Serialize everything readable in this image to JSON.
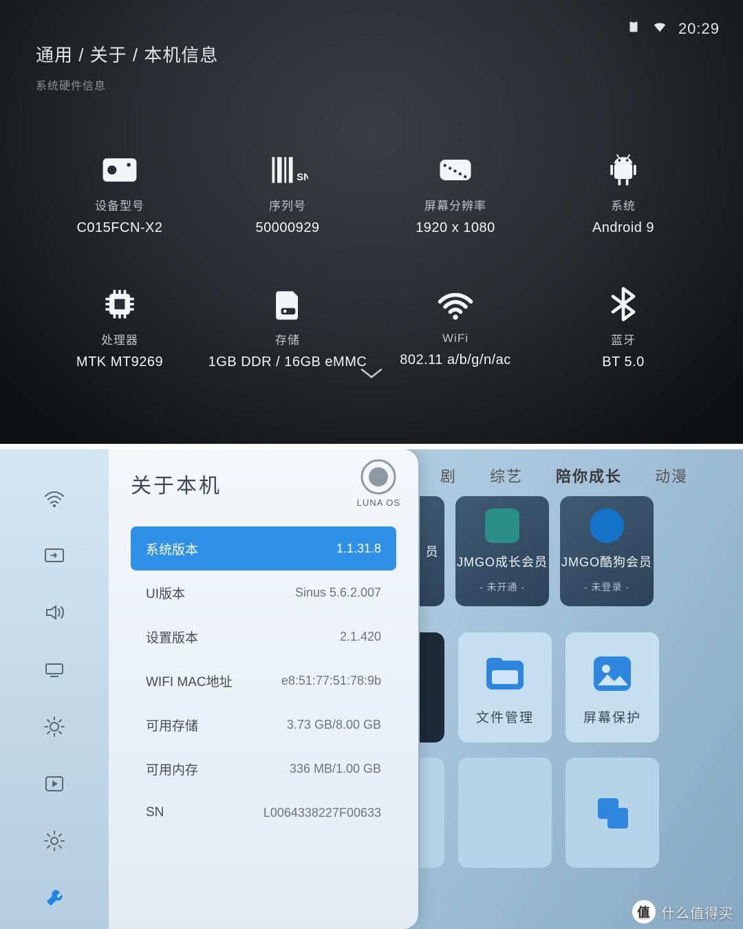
{
  "top": {
    "time": "20:29",
    "breadcrumb": "通用 / 关于 / 本机信息",
    "subtitle": "系统硬件信息",
    "tiles": [
      {
        "label": "设备型号",
        "value": "C015FCN-X2",
        "icon": "device-model-icon"
      },
      {
        "label": "序列号",
        "value": "50000929",
        "icon": "barcode-sn-icon"
      },
      {
        "label": "屏幕分辨率",
        "value": "1920 x 1080",
        "icon": "resolution-icon"
      },
      {
        "label": "系统",
        "value": "Android 9",
        "icon": "android-icon"
      },
      {
        "label": "处理器",
        "value": "MTK MT9269",
        "icon": "cpu-icon"
      },
      {
        "label": "存储",
        "value": "1GB DDR / 16GB eMMC",
        "icon": "storage-icon"
      },
      {
        "label": "WiFi",
        "value": "802.11 a/b/g/n/ac",
        "icon": "wifi-icon"
      },
      {
        "label": "蓝牙",
        "value": "BT 5.0",
        "icon": "bluetooth-icon"
      }
    ]
  },
  "bot": {
    "panel_title": "关于本机",
    "brand": "LUNA OS",
    "rows": [
      {
        "label": "系统版本",
        "value": "1.1.31.8",
        "selected": true
      },
      {
        "label": "UI版本",
        "value": "Sinus 5.6.2.007",
        "selected": false
      },
      {
        "label": "设置版本",
        "value": "2.1.420",
        "selected": false
      },
      {
        "label": "WIFI MAC地址",
        "value": "e8:51:77:51:78:9b",
        "selected": false
      },
      {
        "label": "可用存储",
        "value": "3.73 GB/8.00 GB",
        "selected": false
      },
      {
        "label": "可用内存",
        "value": "336 MB/1.00 GB",
        "selected": false
      },
      {
        "label": "SN",
        "value": "L0064338227F00633",
        "selected": false
      }
    ],
    "bg_tabs": [
      "剧",
      "综艺",
      "陪你成长",
      "动漫"
    ],
    "bg_tabs_active": "陪你成长",
    "members": [
      {
        "label": "员",
        "sub": "",
        "color": "#3a9a48"
      },
      {
        "label": "JMGO成长会员",
        "sub": "- 未开通 -",
        "color": "#2a8f86"
      },
      {
        "label": "JMGO酷狗会员",
        "sub": "- 未登录 -",
        "color": "#1374c9"
      }
    ],
    "apps": [
      {
        "label": "文件管理",
        "name": "app-file-manager"
      },
      {
        "label": "屏幕保护",
        "name": "app-screensaver"
      }
    ]
  },
  "watermark": {
    "badge": "值",
    "text": "什么值得买"
  }
}
